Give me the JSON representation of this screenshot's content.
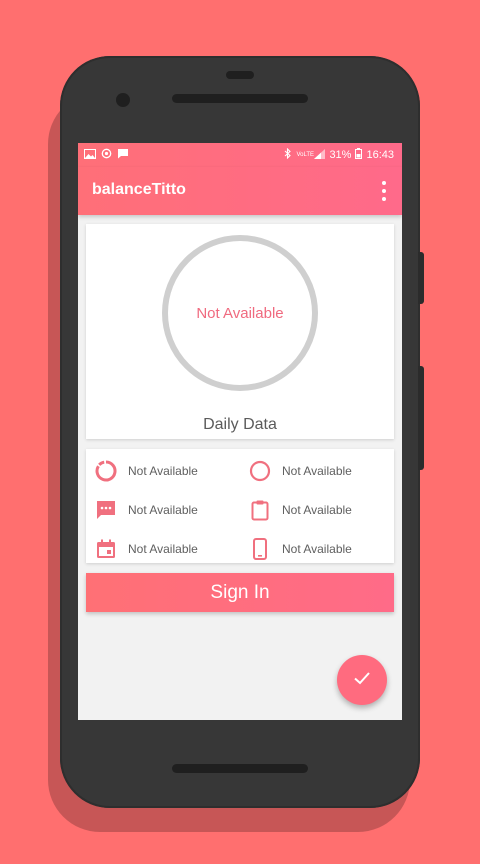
{
  "theme": {
    "accent": "#ff6b7f",
    "background": "#ff6f6f",
    "ring_color": "#cfcfcf"
  },
  "status_bar": {
    "icons_left": [
      "image-icon",
      "sync-icon",
      "message-icon"
    ],
    "network_label": "VoLTE",
    "battery_percent": "31%",
    "time": "16:43"
  },
  "app_bar": {
    "title": "balanceTitto",
    "menu_icon": "overflow-menu-icon"
  },
  "daily_card": {
    "ring_text": "Not Available",
    "caption": "Daily Data"
  },
  "stats": [
    {
      "icon": "data-usage-icon",
      "label": "Not Available"
    },
    {
      "icon": "circle-icon",
      "label": "Not Available"
    },
    {
      "icon": "sms-icon",
      "label": "Not Available"
    },
    {
      "icon": "clipboard-icon",
      "label": "Not Available"
    },
    {
      "icon": "calendar-icon",
      "label": "Not Available"
    },
    {
      "icon": "phone-icon",
      "label": "Not Available"
    }
  ],
  "sign_in": {
    "label": "Sign In"
  },
  "fab": {
    "icon": "check-icon"
  }
}
